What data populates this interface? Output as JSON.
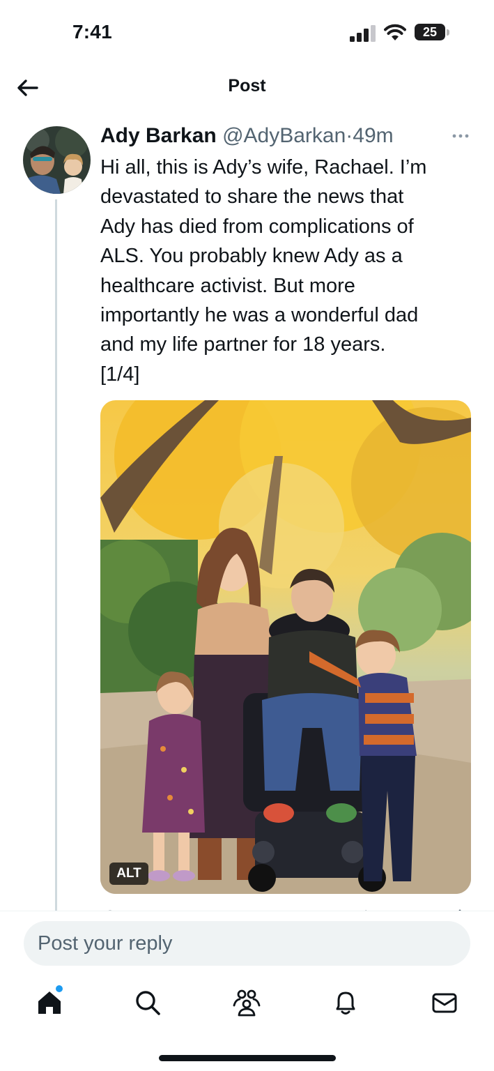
{
  "status_bar": {
    "time": "7:41",
    "battery": "25"
  },
  "header": {
    "title": "Post"
  },
  "post": {
    "author_name": "Ady Barkan",
    "author_handle": "@AdyBarkan",
    "separator": "·",
    "time": "49m",
    "text": "Hi all, this is Ady’s wife, Rachael. I’m\ndevastated to share the news that\nAdy has died from complications of\nALS. You probably knew Ady as a\nhealthcare activist. But more\nimportantly he was a wonderful dad\nand my life partner for 18 years.\n[1/4]",
    "media_alt_badge": "ALT"
  },
  "reply": {
    "placeholder": "Post your reply"
  },
  "tab_bar": {
    "items": [
      "home-icon",
      "search-icon",
      "communities-icon",
      "notifications-icon",
      "messages-icon"
    ]
  },
  "colors": {
    "accent": "#1d9bf0",
    "text": "#0f1419",
    "secondary": "#536471",
    "reply_bg": "#eff3f4",
    "thread_line": "#cfd9de"
  }
}
